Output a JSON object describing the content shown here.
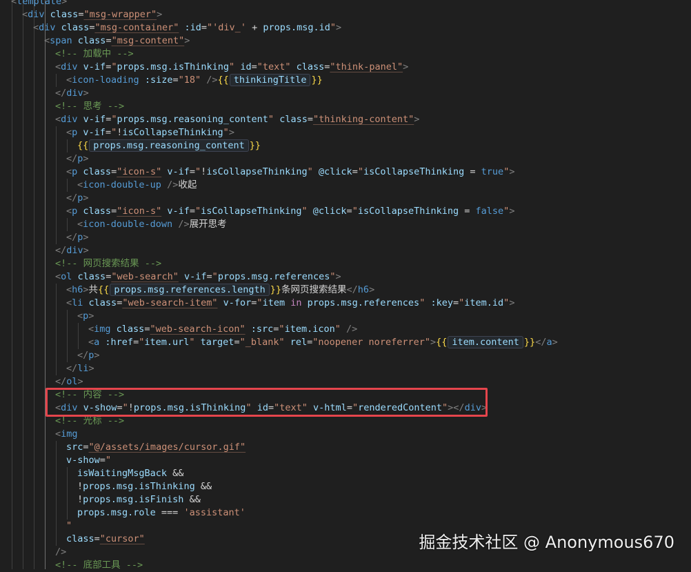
{
  "editor": {
    "lines": [
      [
        [
          "t-br",
          "<"
        ],
        [
          "t-tag",
          "template"
        ],
        [
          "t-br",
          ">"
        ]
      ],
      [
        [
          "t-br",
          "<"
        ],
        [
          "t-tag",
          "div"
        ],
        [
          "t-op",
          " "
        ],
        [
          "t-attr",
          "class"
        ],
        [
          "t-op",
          "="
        ],
        [
          "t-str",
          "\"msg-wrapper\""
        ],
        [
          "t-br",
          ">"
        ]
      ],
      [
        [
          "t-br",
          "<"
        ],
        [
          "t-tag",
          "div"
        ],
        [
          "t-op",
          " "
        ],
        [
          "t-attr",
          "class"
        ],
        [
          "t-op",
          "="
        ],
        [
          "t-str",
          "\"msg-container\""
        ],
        [
          "t-op",
          " "
        ],
        [
          "t-attr",
          ":id"
        ],
        [
          "t-op",
          "="
        ],
        [
          "t-strp",
          "\"'div_' "
        ],
        [
          "t-op",
          "+ "
        ],
        [
          "t-expr",
          "props.msg.id"
        ],
        [
          "t-strp",
          "\""
        ],
        [
          "t-br",
          ">"
        ]
      ],
      [
        [
          "t-br",
          "<"
        ],
        [
          "t-tag",
          "span"
        ],
        [
          "t-op",
          " "
        ],
        [
          "t-attr",
          "class"
        ],
        [
          "t-op",
          "="
        ],
        [
          "t-str",
          "\"msg-content\""
        ],
        [
          "t-br",
          ">"
        ]
      ],
      [
        [
          "t-cmt",
          "<!-- 加载中 -->"
        ]
      ],
      [
        [
          "t-br",
          "<"
        ],
        [
          "t-tag",
          "div"
        ],
        [
          "t-op",
          " "
        ],
        [
          "t-attr",
          "v-if"
        ],
        [
          "t-op",
          "="
        ],
        [
          "t-strp",
          "\""
        ],
        [
          "t-expr",
          "props.msg.isThinking"
        ],
        [
          "t-strp",
          "\""
        ],
        [
          "t-op",
          " "
        ],
        [
          "t-attr",
          "id"
        ],
        [
          "t-op",
          "="
        ],
        [
          "t-strp",
          "\"text\""
        ],
        [
          "t-op",
          " "
        ],
        [
          "t-attr",
          "class"
        ],
        [
          "t-op",
          "="
        ],
        [
          "t-str",
          "\"think-panel\""
        ],
        [
          "t-br",
          ">"
        ]
      ],
      [
        [
          "t-br",
          "<"
        ],
        [
          "t-tag",
          "icon-loading"
        ],
        [
          "t-op",
          " "
        ],
        [
          "t-attr",
          ":size"
        ],
        [
          "t-op",
          "="
        ],
        [
          "t-strp",
          "\"18\""
        ],
        [
          "t-op",
          " "
        ],
        [
          "t-br",
          "/>"
        ],
        [
          "t-must",
          "{{"
        ],
        [
          "hint-box",
          "thinkingTitle"
        ],
        [
          "t-must",
          "}}"
        ]
      ],
      [
        [
          "t-br",
          "</"
        ],
        [
          "t-tag",
          "div"
        ],
        [
          "t-br",
          ">"
        ]
      ],
      [
        [
          "t-cmt",
          "<!-- 思考 -->"
        ]
      ],
      [
        [
          "t-br",
          "<"
        ],
        [
          "t-tag",
          "div"
        ],
        [
          "t-op",
          " "
        ],
        [
          "t-attr",
          "v-if"
        ],
        [
          "t-op",
          "="
        ],
        [
          "t-strp",
          "\""
        ],
        [
          "t-expr",
          "props.msg.reasoning_content"
        ],
        [
          "t-strp",
          "\""
        ],
        [
          "t-op",
          " "
        ],
        [
          "t-attr",
          "class"
        ],
        [
          "t-op",
          "="
        ],
        [
          "t-str",
          "\"thinking-content\""
        ],
        [
          "t-br",
          ">"
        ]
      ],
      [
        [
          "t-br",
          "<"
        ],
        [
          "t-tag",
          "p"
        ],
        [
          "t-op",
          " "
        ],
        [
          "t-attr",
          "v-if"
        ],
        [
          "t-op",
          "="
        ],
        [
          "t-strp",
          "\""
        ],
        [
          "t-op",
          "!"
        ],
        [
          "t-expr",
          "isCollapseThinking"
        ],
        [
          "t-strp",
          "\""
        ],
        [
          "t-br",
          ">"
        ]
      ],
      [
        [
          "t-must",
          "{{"
        ],
        [
          "hint-box",
          "props.msg.reasoning_content"
        ],
        [
          "t-must",
          "}}"
        ]
      ],
      [
        [
          "t-br",
          "</"
        ],
        [
          "t-tag",
          "p"
        ],
        [
          "t-br",
          ">"
        ]
      ],
      [
        [
          "t-br",
          "<"
        ],
        [
          "t-tag",
          "p"
        ],
        [
          "t-op",
          " "
        ],
        [
          "t-attr",
          "class"
        ],
        [
          "t-op",
          "="
        ],
        [
          "t-str",
          "\"icon-s\""
        ],
        [
          "t-op",
          " "
        ],
        [
          "t-attr",
          "v-if"
        ],
        [
          "t-op",
          "="
        ],
        [
          "t-strp",
          "\""
        ],
        [
          "t-op",
          "!"
        ],
        [
          "t-expr",
          "isCollapseThinking"
        ],
        [
          "t-strp",
          "\""
        ],
        [
          "t-op",
          " "
        ],
        [
          "t-attr",
          "@click"
        ],
        [
          "t-op",
          "="
        ],
        [
          "t-strp",
          "\""
        ],
        [
          "t-expr",
          "isCollapseThinking"
        ],
        [
          "t-op",
          " = "
        ],
        [
          "t-bool",
          "true"
        ],
        [
          "t-strp",
          "\""
        ],
        [
          "t-br",
          ">"
        ]
      ],
      [
        [
          "t-br",
          "<"
        ],
        [
          "t-tag",
          "icon-double-up"
        ],
        [
          "t-op",
          " "
        ],
        [
          "t-br",
          "/>"
        ],
        [
          "t-text",
          "收起"
        ]
      ],
      [
        [
          "t-br",
          "</"
        ],
        [
          "t-tag",
          "p"
        ],
        [
          "t-br",
          ">"
        ]
      ],
      [
        [
          "t-br",
          "<"
        ],
        [
          "t-tag",
          "p"
        ],
        [
          "t-op",
          " "
        ],
        [
          "t-attr",
          "class"
        ],
        [
          "t-op",
          "="
        ],
        [
          "t-str",
          "\"icon-s\""
        ],
        [
          "t-op",
          " "
        ],
        [
          "t-attr",
          "v-if"
        ],
        [
          "t-op",
          "="
        ],
        [
          "t-strp",
          "\""
        ],
        [
          "t-expr",
          "isCollapseThinking"
        ],
        [
          "t-strp",
          "\""
        ],
        [
          "t-op",
          " "
        ],
        [
          "t-attr",
          "@click"
        ],
        [
          "t-op",
          "="
        ],
        [
          "t-strp",
          "\""
        ],
        [
          "t-expr",
          "isCollapseThinking"
        ],
        [
          "t-op",
          " = "
        ],
        [
          "t-bool",
          "false"
        ],
        [
          "t-strp",
          "\""
        ],
        [
          "t-br",
          ">"
        ]
      ],
      [
        [
          "t-br",
          "<"
        ],
        [
          "t-tag",
          "icon-double-down"
        ],
        [
          "t-op",
          " "
        ],
        [
          "t-br",
          "/>"
        ],
        [
          "t-text",
          "展开思考"
        ]
      ],
      [
        [
          "t-br",
          "</"
        ],
        [
          "t-tag",
          "p"
        ],
        [
          "t-br",
          ">"
        ]
      ],
      [
        [
          "t-br",
          "</"
        ],
        [
          "t-tag",
          "div"
        ],
        [
          "t-br",
          ">"
        ]
      ],
      [
        [
          "t-cmt",
          "<!-- 网页搜索结果 -->"
        ]
      ],
      [
        [
          "t-br",
          "<"
        ],
        [
          "t-tag",
          "ol"
        ],
        [
          "t-op",
          " "
        ],
        [
          "t-attr",
          "class"
        ],
        [
          "t-op",
          "="
        ],
        [
          "t-str",
          "\"web-search\""
        ],
        [
          "t-op",
          " "
        ],
        [
          "t-attr",
          "v-if"
        ],
        [
          "t-op",
          "="
        ],
        [
          "t-strp",
          "\""
        ],
        [
          "t-expr",
          "props.msg.references"
        ],
        [
          "t-strp",
          "\""
        ],
        [
          "t-br",
          ">"
        ]
      ],
      [
        [
          "t-br",
          "<"
        ],
        [
          "t-tag",
          "h6"
        ],
        [
          "t-br",
          ">"
        ],
        [
          "t-text",
          "共"
        ],
        [
          "t-must",
          "{{"
        ],
        [
          "hint-box",
          "props.msg.references.length"
        ],
        [
          "t-must",
          "}}"
        ],
        [
          "t-text",
          "条网页搜索结果"
        ],
        [
          "t-br",
          "</"
        ],
        [
          "t-tag",
          "h6"
        ],
        [
          "t-br",
          ">"
        ]
      ],
      [
        [
          "t-br",
          "<"
        ],
        [
          "t-tag",
          "li"
        ],
        [
          "t-op",
          " "
        ],
        [
          "t-attr",
          "class"
        ],
        [
          "t-op",
          "="
        ],
        [
          "t-str",
          "\"web-search-item\""
        ],
        [
          "t-op",
          " "
        ],
        [
          "t-attr",
          "v-for"
        ],
        [
          "t-op",
          "="
        ],
        [
          "t-strp",
          "\""
        ],
        [
          "t-expr",
          "item"
        ],
        [
          "t-op",
          " "
        ],
        [
          "t-kw",
          "in"
        ],
        [
          "t-op",
          " "
        ],
        [
          "t-expr",
          "props.msg.references"
        ],
        [
          "t-strp",
          "\""
        ],
        [
          "t-op",
          " "
        ],
        [
          "t-attr",
          ":key"
        ],
        [
          "t-op",
          "="
        ],
        [
          "t-strp",
          "\""
        ],
        [
          "t-expr",
          "item.id"
        ],
        [
          "t-strp",
          "\""
        ],
        [
          "t-br",
          ">"
        ]
      ],
      [
        [
          "t-br",
          "<"
        ],
        [
          "t-tag",
          "p"
        ],
        [
          "t-br",
          ">"
        ]
      ],
      [
        [
          "t-br",
          "<"
        ],
        [
          "t-tag",
          "img"
        ],
        [
          "t-op",
          " "
        ],
        [
          "t-attr",
          "class"
        ],
        [
          "t-op",
          "="
        ],
        [
          "t-str",
          "\"web-search-icon\""
        ],
        [
          "t-op",
          " "
        ],
        [
          "t-attr",
          ":src"
        ],
        [
          "t-op",
          "="
        ],
        [
          "t-strp",
          "\""
        ],
        [
          "t-expr",
          "item.icon"
        ],
        [
          "t-strp",
          "\""
        ],
        [
          "t-op",
          " "
        ],
        [
          "t-br",
          "/>"
        ]
      ],
      [
        [
          "t-br",
          "<"
        ],
        [
          "t-tag",
          "a"
        ],
        [
          "t-op",
          " "
        ],
        [
          "t-attr",
          ":href"
        ],
        [
          "t-op",
          "="
        ],
        [
          "t-strp",
          "\""
        ],
        [
          "t-expr",
          "item.url"
        ],
        [
          "t-strp",
          "\""
        ],
        [
          "t-op",
          " "
        ],
        [
          "t-attr",
          "target"
        ],
        [
          "t-op",
          "="
        ],
        [
          "t-strp",
          "\"_blank\""
        ],
        [
          "t-op",
          " "
        ],
        [
          "t-attr",
          "rel"
        ],
        [
          "t-op",
          "="
        ],
        [
          "t-strp",
          "\"noopener noreferrer\""
        ],
        [
          "t-br",
          ">"
        ],
        [
          "t-must",
          "{{"
        ],
        [
          "hint-box",
          "item.content"
        ],
        [
          "t-must",
          "}}"
        ],
        [
          "t-br",
          "</"
        ],
        [
          "t-tag",
          "a"
        ],
        [
          "t-br",
          ">"
        ]
      ],
      [
        [
          "t-br",
          "</"
        ],
        [
          "t-tag",
          "p"
        ],
        [
          "t-br",
          ">"
        ]
      ],
      [
        [
          "t-br",
          "</"
        ],
        [
          "t-tag",
          "li"
        ],
        [
          "t-br",
          ">"
        ]
      ],
      [
        [
          "t-br",
          "</"
        ],
        [
          "t-tag",
          "ol"
        ],
        [
          "t-br",
          ">"
        ]
      ],
      [
        [
          "t-cmt",
          "<!-- 内容 -->"
        ]
      ],
      [
        [
          "t-br",
          "<"
        ],
        [
          "t-tag",
          "div"
        ],
        [
          "t-op",
          " "
        ],
        [
          "t-attr",
          "v-show"
        ],
        [
          "t-op",
          "="
        ],
        [
          "t-strp",
          "\""
        ],
        [
          "t-op",
          "!"
        ],
        [
          "t-expr",
          "props.msg.isThinking"
        ],
        [
          "t-strp",
          "\""
        ],
        [
          "t-op",
          " "
        ],
        [
          "t-attr",
          "id"
        ],
        [
          "t-op",
          "="
        ],
        [
          "t-strp",
          "\"text\""
        ],
        [
          "t-op",
          " "
        ],
        [
          "t-attr",
          "v-html"
        ],
        [
          "t-op",
          "="
        ],
        [
          "t-strp",
          "\""
        ],
        [
          "t-expr",
          "renderedContent"
        ],
        [
          "t-strp",
          "\""
        ],
        [
          "t-br",
          "></"
        ],
        [
          "t-tag",
          "div"
        ],
        [
          "t-br",
          ">"
        ]
      ],
      [
        [
          "t-cmt",
          "<!-- 光标 -->"
        ]
      ],
      [
        [
          "t-br",
          "<"
        ],
        [
          "t-tag",
          "img"
        ]
      ],
      [
        [
          "t-attr",
          "src"
        ],
        [
          "t-op",
          "="
        ],
        [
          "t-str",
          "\"@/assets/images/cursor.gif\""
        ]
      ],
      [
        [
          "t-attr",
          "v-show"
        ],
        [
          "t-op",
          "="
        ],
        [
          "t-strp",
          "\""
        ]
      ],
      [
        [
          "t-expr",
          "isWaitingMsgBack"
        ],
        [
          "t-op",
          " &&"
        ]
      ],
      [
        [
          "t-op",
          "!"
        ],
        [
          "t-expr",
          "props.msg.isThinking"
        ],
        [
          "t-op",
          " &&"
        ]
      ],
      [
        [
          "t-op",
          "!"
        ],
        [
          "t-expr",
          "props.msg.isFinish"
        ],
        [
          "t-op",
          " &&"
        ]
      ],
      [
        [
          "t-expr",
          "props.msg.role"
        ],
        [
          "t-op",
          " === "
        ],
        [
          "t-strp",
          "'assistant'"
        ]
      ],
      [
        [
          "t-strp",
          "\""
        ]
      ],
      [
        [
          "t-attr",
          "class"
        ],
        [
          "t-op",
          "="
        ],
        [
          "t-str",
          "\"cursor\""
        ]
      ],
      [
        [
          "t-br",
          "/>"
        ]
      ],
      [
        [
          "t-cmt",
          "<!-- 底部工具 -->"
        ]
      ]
    ]
  },
  "watermark": "掘金技术社区 @ Anonymous670"
}
